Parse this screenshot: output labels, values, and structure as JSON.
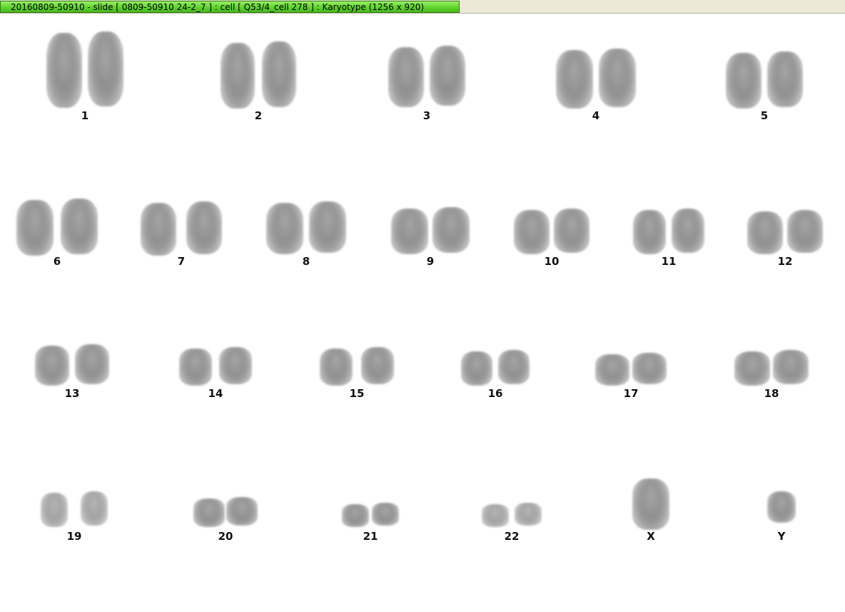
{
  "window": {
    "title": "20160809-50910 - slide [ 0809-50910 24-2_7 ] : cell [ Q53/4_cell 278 ] : Karyotype  (1256 x 920)"
  },
  "karyotype": {
    "chromosomes": [
      {
        "id": "c1",
        "label": "1"
      },
      {
        "id": "c2",
        "label": "2"
      },
      {
        "id": "c3",
        "label": "3"
      },
      {
        "id": "c4",
        "label": "4"
      },
      {
        "id": "c5",
        "label": "5"
      },
      {
        "id": "c6",
        "label": "6"
      },
      {
        "id": "c7",
        "label": "7"
      },
      {
        "id": "c8",
        "label": "8"
      },
      {
        "id": "c9",
        "label": "9"
      },
      {
        "id": "c10",
        "label": "10"
      },
      {
        "id": "c11",
        "label": "11"
      },
      {
        "id": "c12",
        "label": "12"
      },
      {
        "id": "c13",
        "label": "13"
      },
      {
        "id": "c14",
        "label": "14"
      },
      {
        "id": "c15",
        "label": "15"
      },
      {
        "id": "c16",
        "label": "16"
      },
      {
        "id": "c17",
        "label": "17"
      },
      {
        "id": "c18",
        "label": "18"
      },
      {
        "id": "c19",
        "label": "19"
      },
      {
        "id": "c20",
        "label": "20"
      },
      {
        "id": "c21",
        "label": "21"
      },
      {
        "id": "c22",
        "label": "22"
      },
      {
        "id": "cX",
        "label": "X"
      },
      {
        "id": "cY",
        "label": "Y"
      }
    ]
  }
}
